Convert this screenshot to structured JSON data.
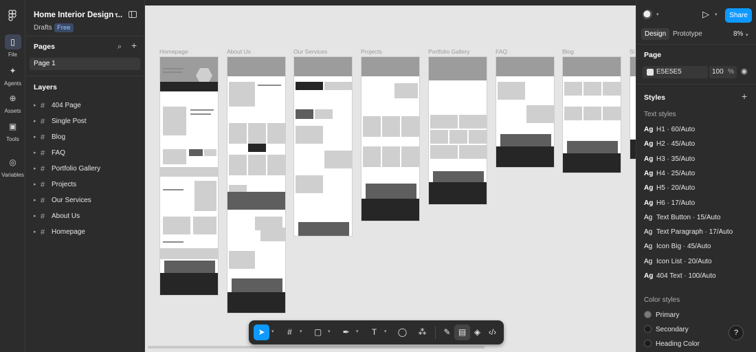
{
  "rail": {
    "file": "File",
    "assets": "Assets",
    "agents": "Agents",
    "tools": "Tools",
    "variables": "Variables"
  },
  "left": {
    "file_title": "Home Interior Design ...",
    "drafts": "Drafts",
    "plan_badge": "Free",
    "pages_title": "Pages",
    "current_page": "Page 1",
    "layers_title": "Layers",
    "layers": [
      "404 Page",
      "Single Post",
      "Blog",
      "FAQ",
      "Portfolio Gallery",
      "Projects",
      "Our Services",
      "About Us",
      "Homepage"
    ]
  },
  "canvas": {
    "background": "#E5E5E5",
    "frames": [
      {
        "label": "Homepage"
      },
      {
        "label": "About Us"
      },
      {
        "label": "Our Services"
      },
      {
        "label": "Projects"
      },
      {
        "label": "Portfolio Gallery"
      },
      {
        "label": "FAQ"
      },
      {
        "label": "Blog"
      },
      {
        "label": "Si"
      }
    ]
  },
  "right": {
    "share": "Share",
    "tab_design": "Design",
    "tab_prototype": "Prototype",
    "zoom": "8%",
    "page_section": "Page",
    "page_fill_hex": "E5E5E5",
    "page_fill_opacity": "100",
    "percent_sign": "%",
    "styles_title": "Styles",
    "text_styles_label": "Text styles",
    "text_styles": [
      {
        "ag": "Ag",
        "name": "H1 · 60/Auto",
        "bold": true
      },
      {
        "ag": "Ag",
        "name": "H2 · 45/Auto",
        "bold": true
      },
      {
        "ag": "Ag",
        "name": "H3 · 35/Auto",
        "bold": true
      },
      {
        "ag": "Ag",
        "name": "H4 · 25/Auto",
        "bold": true
      },
      {
        "ag": "Ag",
        "name": "H5 · 20/Auto",
        "bold": true
      },
      {
        "ag": "Ag",
        "name": "H6 · 17/Auto",
        "bold": true
      },
      {
        "ag": "Ag",
        "name": "Text Button · 15/Auto",
        "bold": false
      },
      {
        "ag": "Ag",
        "name": "Text Paragraph · 17/Auto",
        "bold": false
      },
      {
        "ag": "Ag",
        "name": "Icon Big · 45/Auto",
        "bold": false
      },
      {
        "ag": "Ag",
        "name": "Icon List · 20/Auto",
        "bold": false
      },
      {
        "ag": "Ag",
        "name": "404 Text · 100/Auto",
        "bold": true
      }
    ],
    "color_styles_label": "Color styles",
    "color_styles": [
      {
        "name": "Primary",
        "color": "#7A7A7A"
      },
      {
        "name": "Secondary",
        "color": "#1C1C1C"
      },
      {
        "name": "Heading Color",
        "color": "#1C1C1C"
      }
    ],
    "help": "?"
  },
  "colors": {
    "accent": "#0D99FF",
    "panel": "#2C2C2C"
  }
}
